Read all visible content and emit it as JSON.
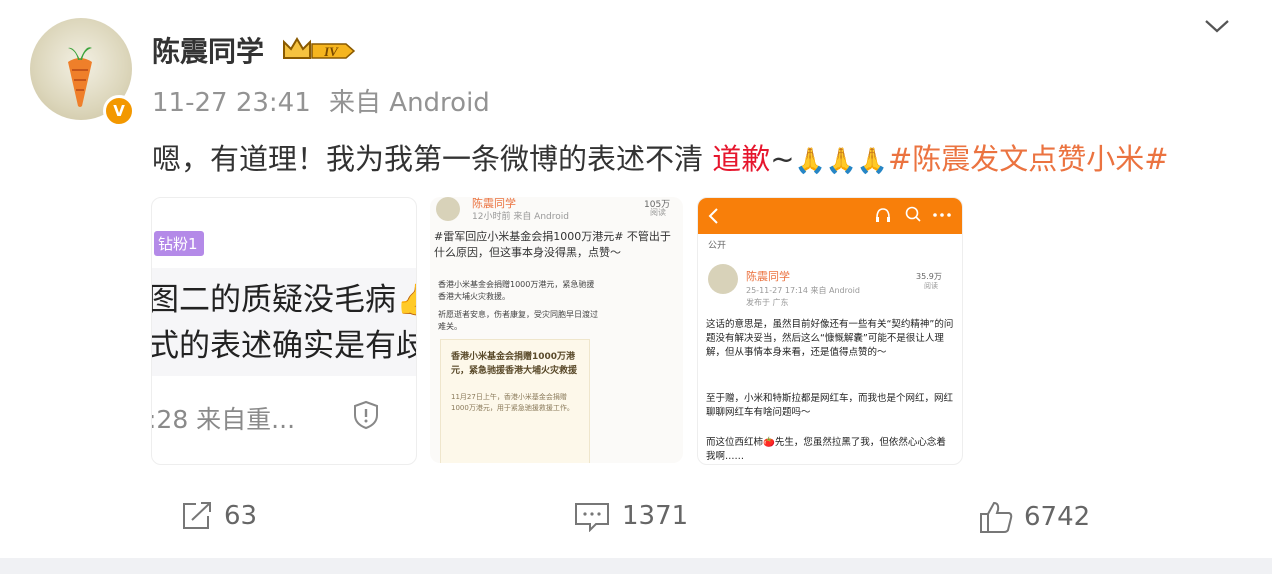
{
  "post": {
    "username": "陈震同学",
    "level_badge": "IV",
    "time": "11-27 23:41",
    "source": "来自 Android",
    "content": {
      "text": "嗯，有道理！我为我第一条微博的表述不清 ",
      "highlight": "道歉",
      "tilde": "~",
      "emoji": "🙏🙏🙏",
      "hashtag": "#陈震发文点赞小米#"
    }
  },
  "thumbnails": {
    "t1": {
      "badge": "钻粉1",
      "line1": "图二的质疑没毛病👍",
      "line2": "式的表述确实是有歧",
      "footer": ":28 来自重..."
    },
    "t2": {
      "name": "陈震同学",
      "meta": "12小时前  来自 Android",
      "count": "105万",
      "count_sub": "阅读",
      "headline": "#雷军回应小米基金会捐1000万港元# 不管出于什么原因，但这事本身没得黑，点赞～",
      "p1": "香港小米基金会捐赠1000万港元，紧急驰援香港大埔火灾救援。",
      "p2": "祈愿逝者安息，伤者康复，受灾同胞早日渡过难关。",
      "card_title": "香港小米基金会捐赠1000万港元，紧急驰援香港大埔火灾救援",
      "card_body": "11月27日上午，香港小米基金会捐赠1000万港元，用于紧急驰援救援工作。"
    },
    "t3": {
      "public": "公开",
      "name": "陈震同学",
      "time": "25-11-27 17:14  来自 Android",
      "location": "发布于 广东",
      "count": "35.9万",
      "count_sub": "阅读",
      "p1": "这话的意思是，虽然目前好像还有一些有关“契约精神”的问题没有解决妥当，然后这么“慷慨解囊”可能不是很让人理解，但从事情本身来看，还是值得点赞的～",
      "p2": "至于赠，小米和特斯拉都是网红车，而我也是个网红，网红聊聊网红车有啥问题吗～",
      "p3": "而这位西红柿🍅先生，您虽然拉黑了我，但依然心心念着我啊……"
    }
  },
  "stats": {
    "reposts": "63",
    "comments": "1371",
    "likes": "6742"
  },
  "colors": {
    "accent_red": "#e6162d",
    "hashtag": "#eb7340",
    "orange_bar": "#f87f0a",
    "verified": "#f39800"
  }
}
